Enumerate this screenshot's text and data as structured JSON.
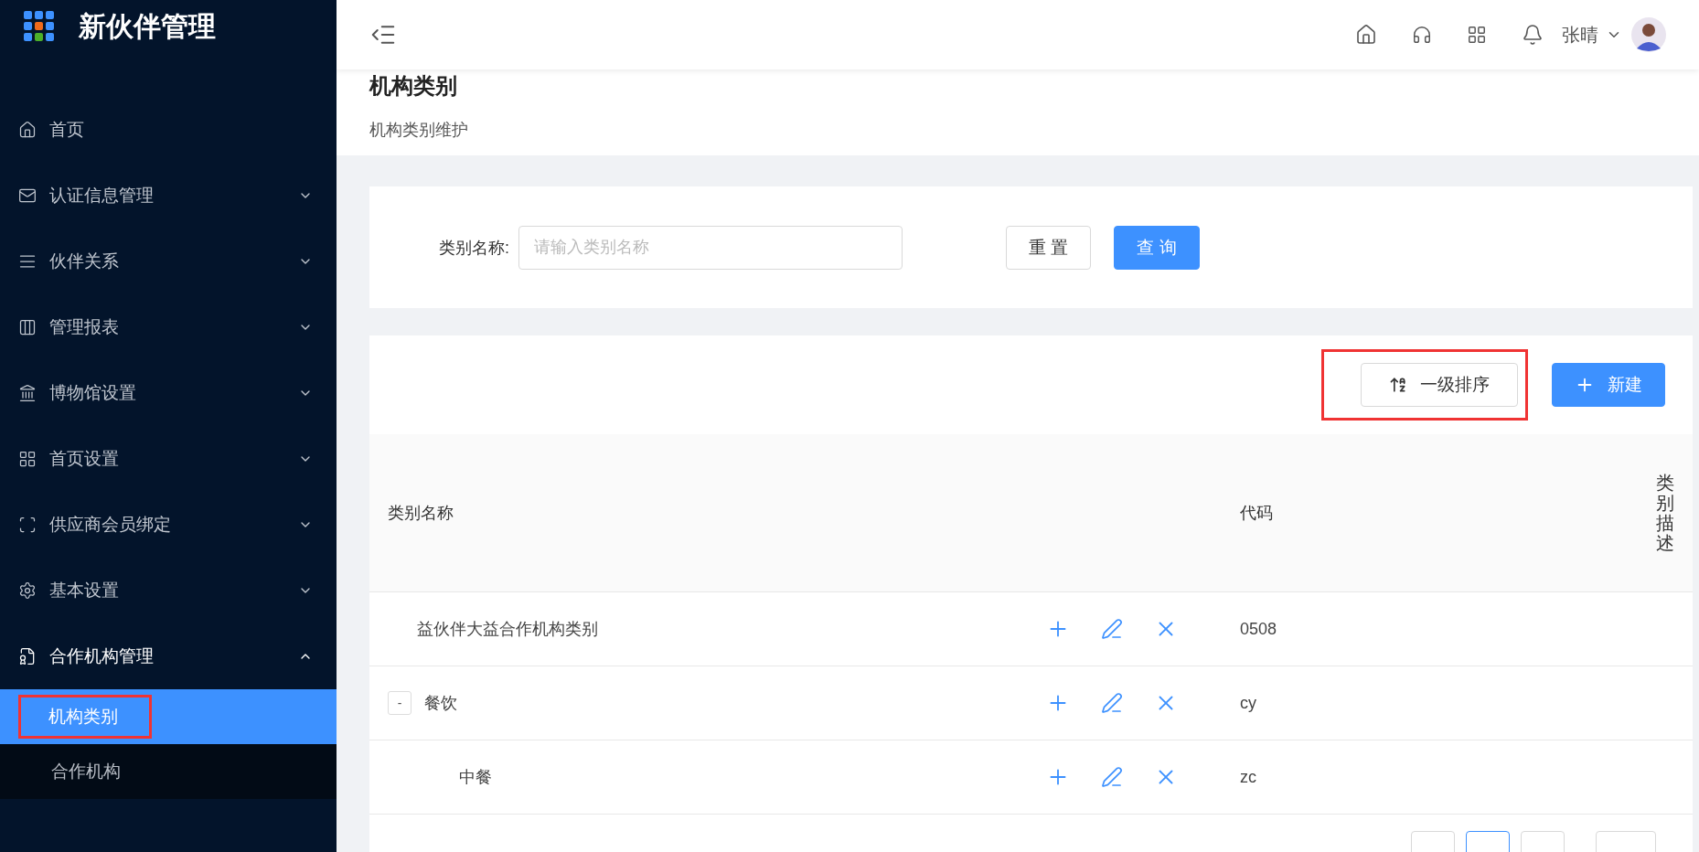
{
  "app": {
    "title": "新伙伴管理"
  },
  "sidebar": {
    "items": [
      {
        "label": "首页",
        "kind": "link"
      },
      {
        "label": "认证信息管理",
        "kind": "group",
        "expanded": false
      },
      {
        "label": "伙伴关系",
        "kind": "group",
        "expanded": false
      },
      {
        "label": "管理报表",
        "kind": "group",
        "expanded": false
      },
      {
        "label": "博物馆设置",
        "kind": "group",
        "expanded": false
      },
      {
        "label": "首页设置",
        "kind": "group",
        "expanded": false
      },
      {
        "label": "供应商会员绑定",
        "kind": "group",
        "expanded": false
      },
      {
        "label": "基本设置",
        "kind": "group",
        "expanded": false
      },
      {
        "label": "合作机构管理",
        "kind": "group",
        "expanded": true,
        "children": [
          {
            "label": "机构类别",
            "selected": true,
            "highlighted": true
          },
          {
            "label": "合作机构",
            "selected": false,
            "highlighted": false
          }
        ]
      }
    ]
  },
  "header": {
    "user": "张晴"
  },
  "page": {
    "title": "机构类别",
    "subtitle": "机构类别维护"
  },
  "search": {
    "label": "类别名称:",
    "placeholder": "请输入类别名称",
    "buttons": [
      {
        "label": "重 置",
        "kind": "default"
      },
      {
        "label": "查 询",
        "kind": "primary"
      }
    ]
  },
  "toolbar": {
    "buttons": [
      {
        "label": "一级排序",
        "kind": "sort",
        "highlighted": true
      },
      {
        "label": "新建",
        "kind": "add",
        "highlighted": false
      }
    ]
  },
  "table": {
    "columns": [
      "类别名称",
      "代码",
      "类别描述"
    ],
    "rows": [
      {
        "name": "益伙伴大益合作机构类别",
        "code": "0508"
      },
      {
        "name": "餐饮",
        "code": "cy",
        "toggle": "-",
        "expanded": true,
        "children": [
          {
            "name": "中餐",
            "code": "zc"
          }
        ]
      }
    ]
  }
}
